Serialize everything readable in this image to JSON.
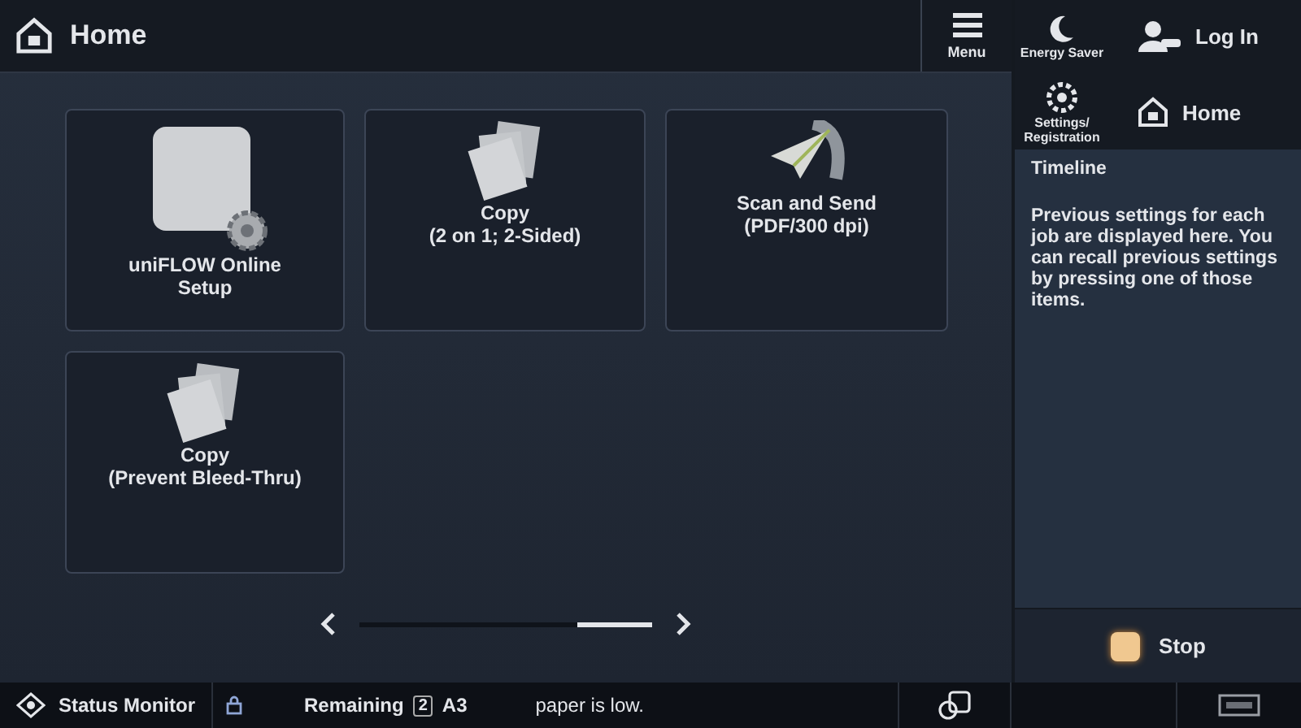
{
  "header": {
    "title": "Home",
    "menu_label": "Menu"
  },
  "side_buttons": [
    {
      "kind": "energy",
      "label": "Energy Saver"
    },
    {
      "kind": "login",
      "label": "Log In"
    },
    {
      "kind": "settings",
      "label": "Settings/ Registration"
    },
    {
      "kind": "home",
      "label": "Home"
    }
  ],
  "tiles": [
    {
      "kind": "uniflow",
      "lines": [
        "uniFLOW Online",
        "Setup"
      ]
    },
    {
      "kind": "copy",
      "lines": [
        "Copy",
        "(2 on 1; 2-Sided)"
      ]
    },
    {
      "kind": "send",
      "lines": [
        "Scan and Send",
        "(PDF/300 dpi)"
      ]
    },
    {
      "kind": "copy",
      "lines": [
        "Copy",
        "(Prevent Bleed-Thru)"
      ]
    }
  ],
  "timeline": {
    "title": "Timeline",
    "text": "Previous settings for each job are displayed here. You can recall previous settings by pressing one of those items."
  },
  "stop_label": "Stop",
  "status_bar": {
    "monitor": "Status Monitor",
    "remaining": "Remaining",
    "count": "2",
    "paper_size": "A3",
    "message": "paper is low."
  }
}
